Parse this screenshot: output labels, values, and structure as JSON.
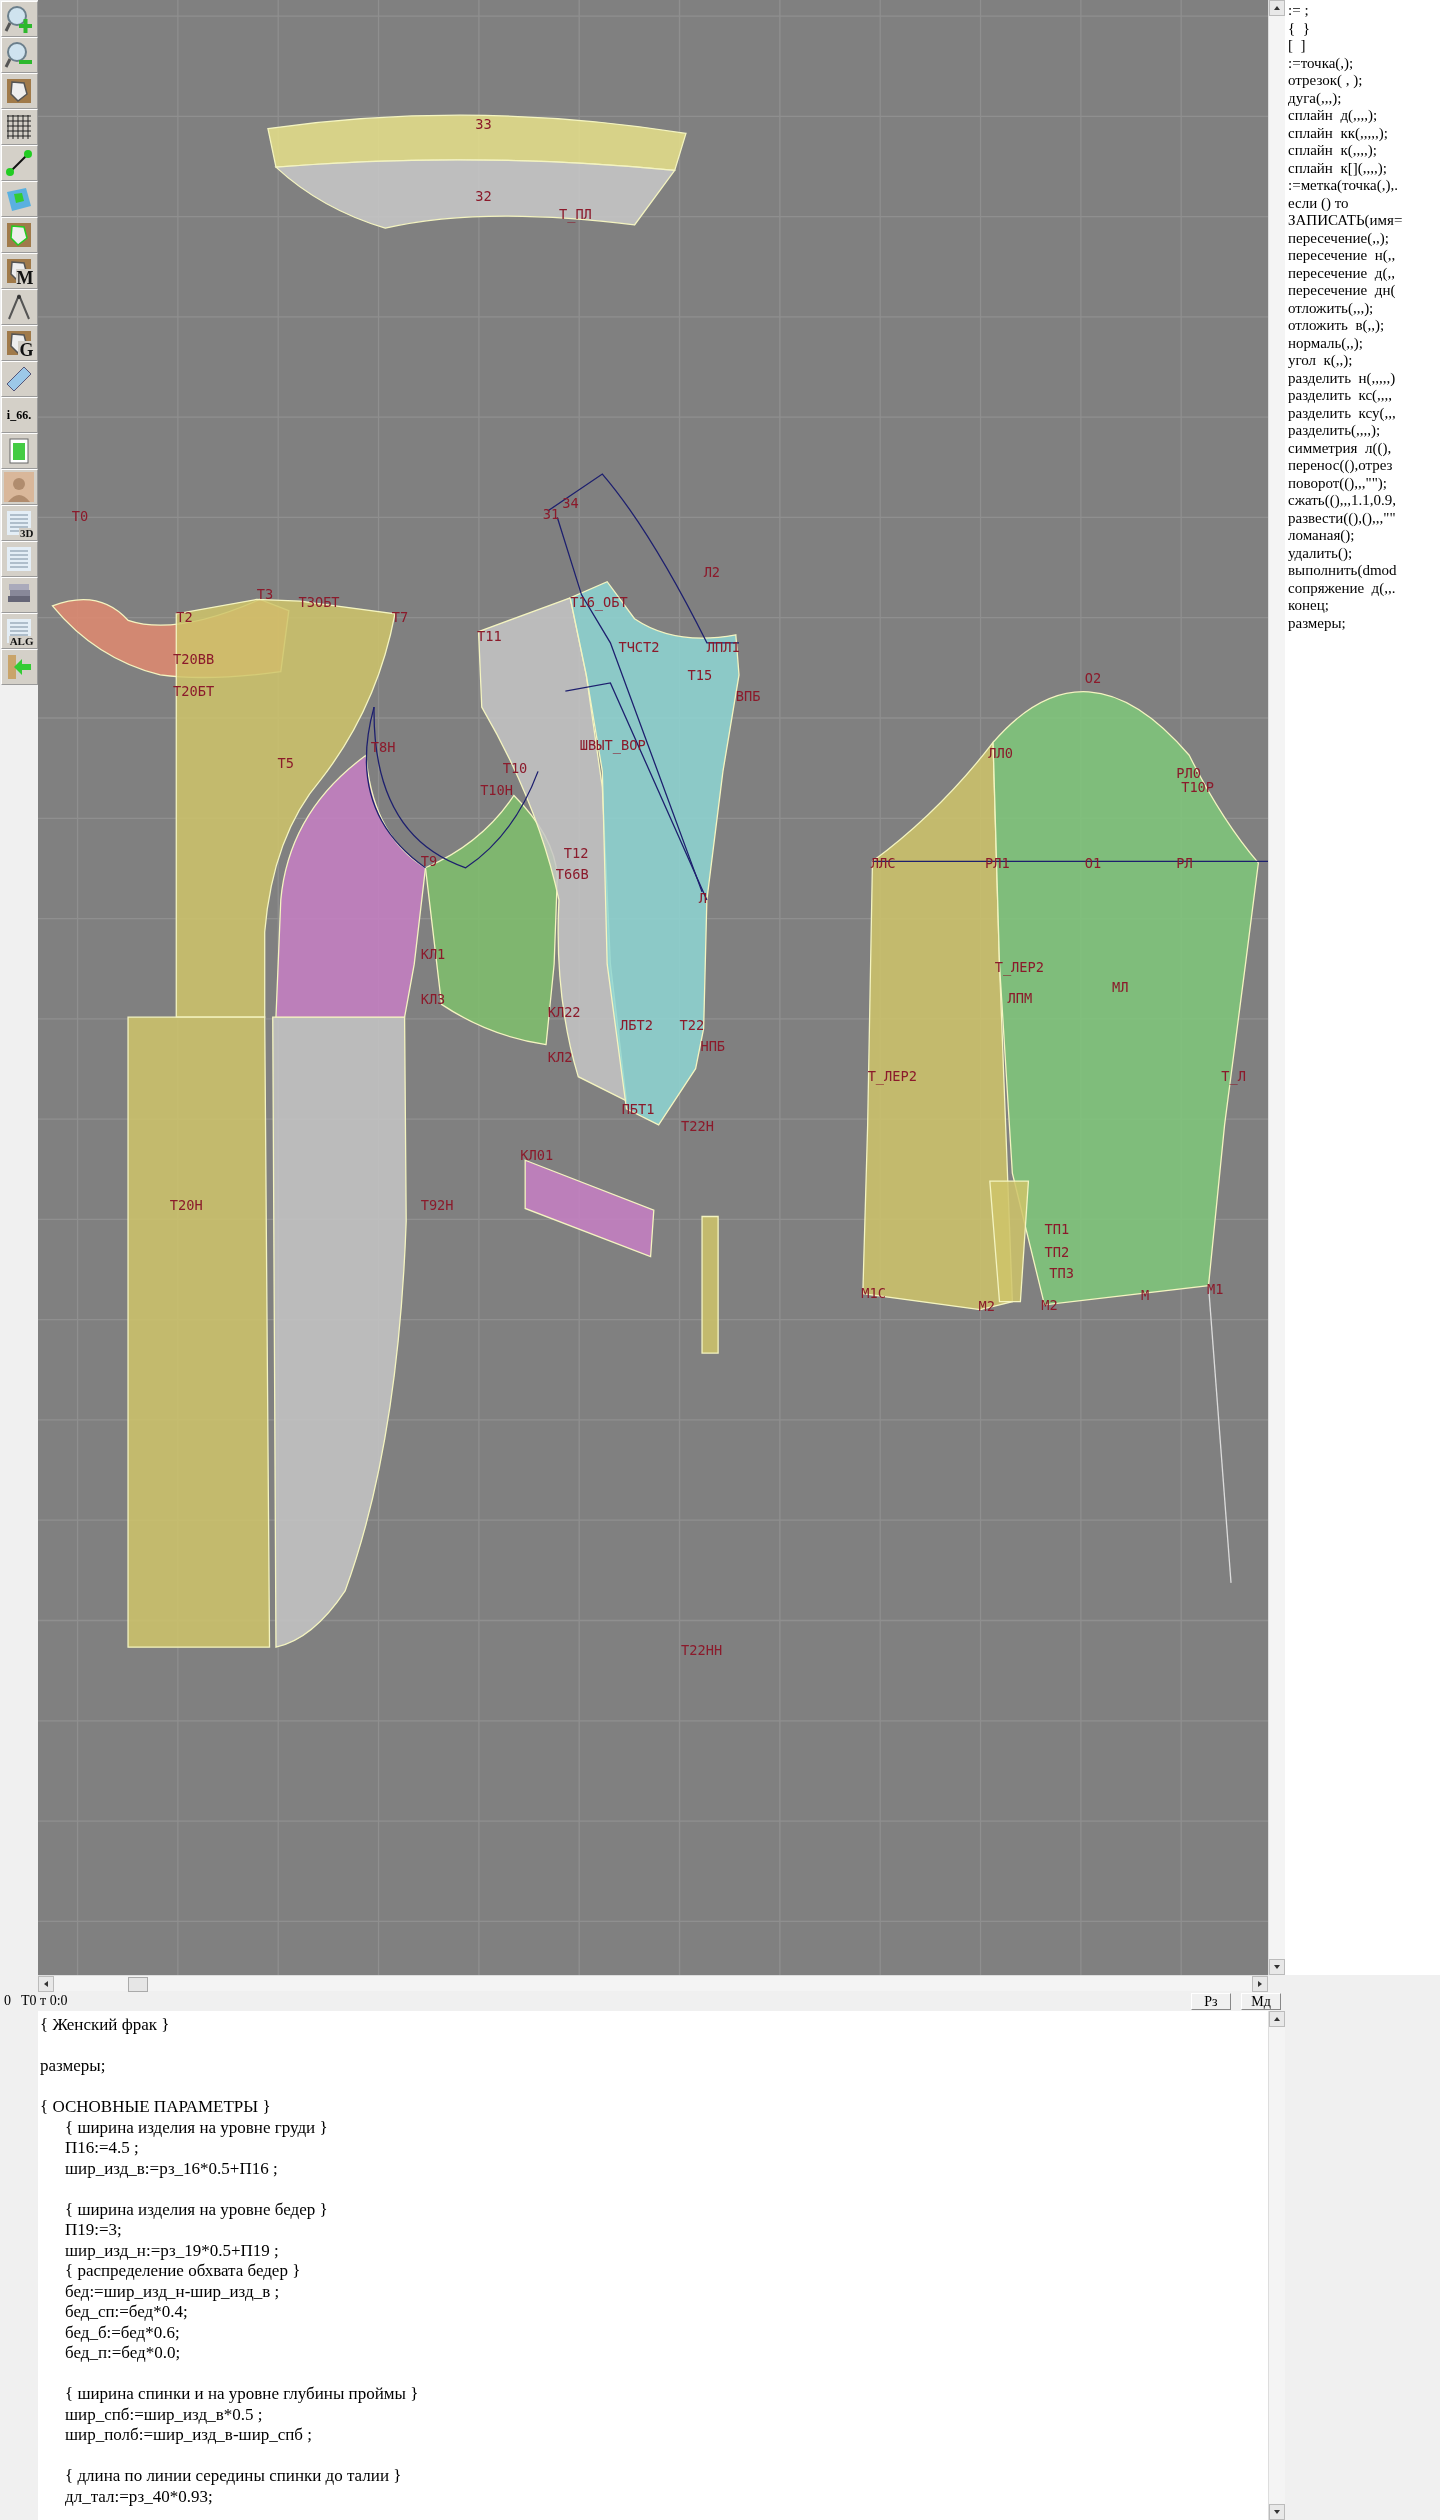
{
  "toolbar": [
    {
      "kind": "zoom-in"
    },
    {
      "kind": "zoom-out"
    },
    {
      "kind": "pattern"
    },
    {
      "kind": "grid"
    },
    {
      "kind": "segment"
    },
    {
      "kind": "map"
    },
    {
      "kind": "pattern-green"
    },
    {
      "kind": "letter",
      "label": "M"
    },
    {
      "kind": "compass"
    },
    {
      "kind": "letter",
      "label": "G"
    },
    {
      "kind": "ruler"
    },
    {
      "kind": "text",
      "label": "i_66."
    },
    {
      "kind": "table"
    },
    {
      "kind": "photo"
    },
    {
      "kind": "letter",
      "label": "3D"
    },
    {
      "kind": "list"
    },
    {
      "kind": "books"
    },
    {
      "kind": "letter",
      "label": "ALG"
    },
    {
      "kind": "exit"
    }
  ],
  "canvas": {
    "labels": [
      "33",
      "32",
      "Т_ПЛ",
      "Т0",
      "31",
      "34",
      "Л2",
      "Т2",
      "Т3",
      "Т3ОБТ",
      "Т7",
      "Т20ВВ",
      "Т20БТ",
      "Т5",
      "Т8Н",
      "Т11",
      "Т16_ОБТ",
      "ТЧСТ2",
      "ЛПЛ1",
      "Т15",
      "ВПБ",
      "ШВЫТ_ВОР",
      "Т10",
      "Т10Н",
      "Т9",
      "Т12",
      "Т66В",
      "Л",
      "КЛ1",
      "КЛ3",
      "КЛ22",
      "ЛБТ2",
      "Т22",
      "НПБ",
      "КЛ2",
      "ПБТ1",
      "Т22Н",
      "КЛ01",
      "Т20Н",
      "Т92Н",
      "Т22НН",
      "О2",
      "ЛЛ0",
      "РЛ0",
      "Т10Р",
      "ЛЛС",
      "РЛ1",
      "О1",
      "РЛ",
      "Т_ЛЕР2",
      "МЛ",
      "ЛПМ",
      "Т_ЛЕР2",
      "Т_Л",
      "ТП1",
      "ТП2",
      "ТП3",
      "М1С",
      "М2",
      "М2",
      "М",
      "М1"
    ]
  },
  "commands": [
    ":= ;",
    "{  }",
    "[  ]",
    ":=точка(,);",
    "отрезок( , );",
    "дуга(,,,);",
    "сплайн  д(,,,,);",
    "сплайн  кк(,,,,,);",
    "сплайн  к(,,,,);",
    "сплайн  к[](,,,,);",
    ":=метка(точка(,),.",
    "если () то",
    "ЗАПИСАТЬ(имя=",
    "пересечение(,,);",
    "пересечение  н(,,",
    "пересечение  д(,,",
    "пересечение  дн(",
    "отложить(,,,);",
    "отложить  в(,,);",
    "нормаль(,,);",
    "угол  к(,,);",
    "разделить  н(,,,,,)",
    "разделить  кс(,,,,",
    "разделить  ксу(,,,",
    "разделить(,,,,);",
    "симметрия  л((),",
    "перенос((),отрез",
    "поворот((),,,\"\");",
    "сжать((),,,1.1,0.9,",
    "развести((),(),,,\"\"",
    "ломаная();",
    "удалить();",
    "выполнить(dmod",
    "сопряжение  д(,,.",
    "конец;",
    "размеры;"
  ],
  "status": {
    "coordinate": "0",
    "point": "Т0 т 0:0",
    "buttons": [
      "Рз",
      "Мд"
    ]
  },
  "code": [
    [
      {
        "text": "{ Женский фрак }",
        "indented": false
      }
    ],
    [
      {
        "text": "размеры;",
        "indented": false
      }
    ],
    [
      {
        "text": "{ ОСНОВНЫЕ ПАРАМЕТРЫ }",
        "indented": false
      },
      {
        "text": "{ ширина изделия на уровне груди }",
        "indented": true
      },
      {
        "text": "П16:=4.5 ;",
        "indented": true
      },
      {
        "text": "шир_изд_в:=рз_16*0.5+П16 ;",
        "indented": true
      }
    ],
    [
      {
        "text": "{ ширина изделия на уровне бедер }",
        "indented": true
      },
      {
        "text": "П19:=3;",
        "indented": true
      },
      {
        "text": "шир_изд_н:=рз_19*0.5+П19 ;",
        "indented": true
      },
      {
        "text": "{ распределение обхвата бедер }",
        "indented": true
      },
      {
        "text": "бед:=шир_изд_н-шир_изд_в ;",
        "indented": true
      },
      {
        "text": "бед_сп:=бед*0.4;",
        "indented": true
      },
      {
        "text": "бед_б:=бед*0.6;",
        "indented": true
      },
      {
        "text": "бед_п:=бед*0.0;",
        "indented": true
      }
    ],
    [
      {
        "text": "{ ширина спинки и на уровне глубины проймы }",
        "indented": true
      },
      {
        "text": "шир_спб:=шир_изд_в*0.5 ;",
        "indented": true
      },
      {
        "text": "шир_полб:=шир_изд_в-шир_спб ;",
        "indented": true
      }
    ],
    [
      {
        "text": "{ длина по линии середины спинки до талии }",
        "indented": true
      },
      {
        "text": "дл_тал:=рз_40*0.93;",
        "indented": true
      }
    ]
  ]
}
